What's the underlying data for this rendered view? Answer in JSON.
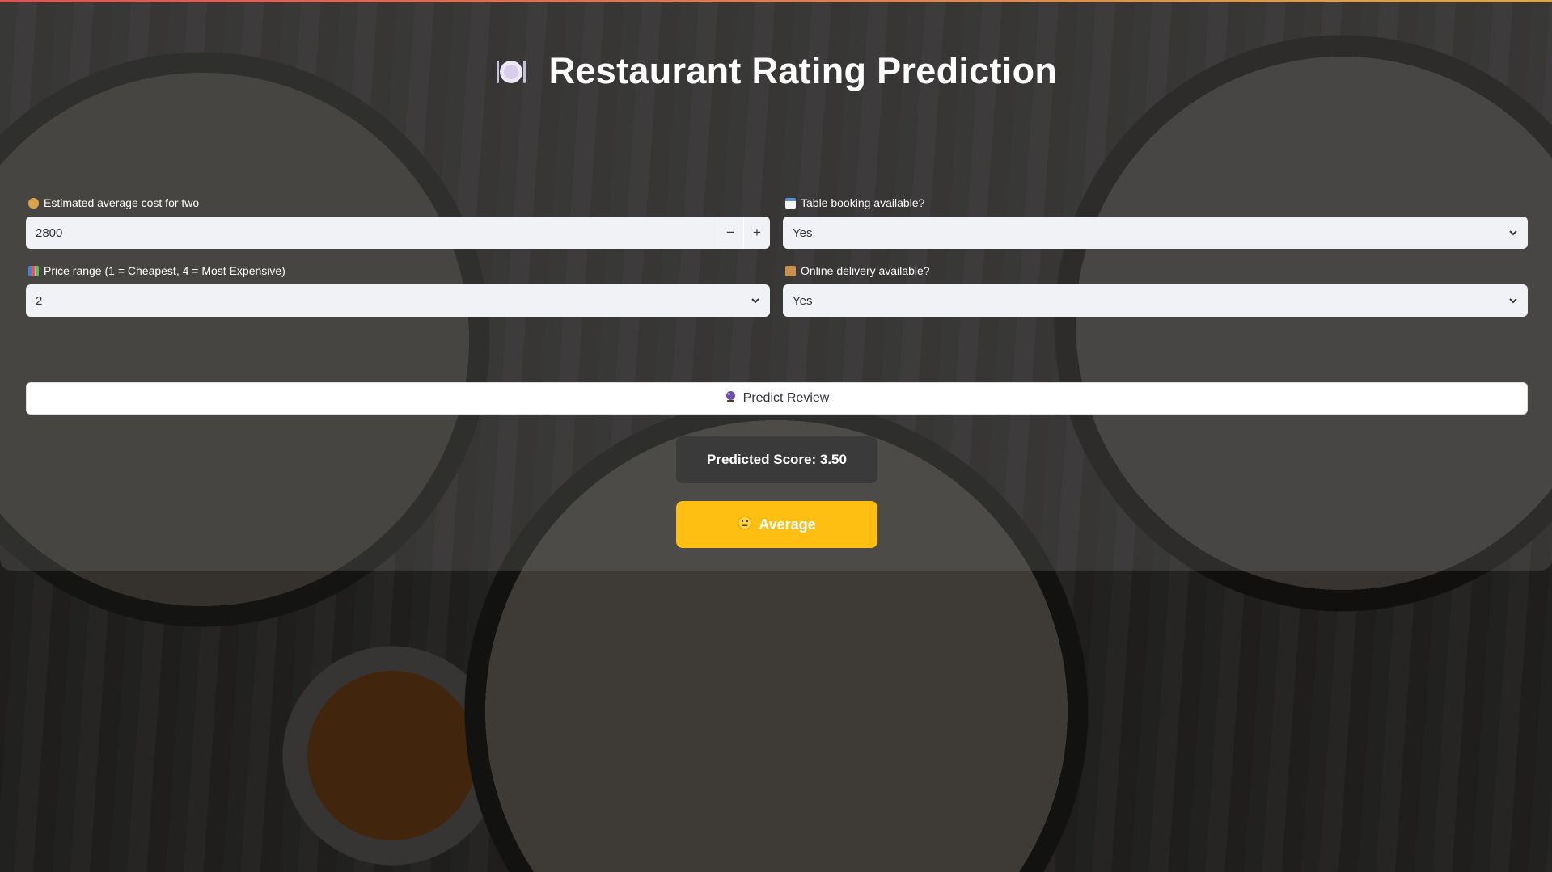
{
  "app": {
    "title": "Restaurant Rating Prediction",
    "title_icon": "plate-cutlery-icon",
    "accent_gradient": [
      "#ff4b4b",
      "#ffbd45"
    ]
  },
  "form": {
    "cost": {
      "label": "Estimated average cost for two",
      "icon": "money-bag-icon",
      "value": "2800",
      "decrement": "−",
      "increment": "+"
    },
    "table_booking": {
      "label": "Table booking available?",
      "icon": "calendar-icon",
      "value": "Yes"
    },
    "price_range": {
      "label": "Price range (1 = Cheapest, 4 = Most Expensive)",
      "icon": "bar-chart-icon",
      "value": "2"
    },
    "online_delivery": {
      "label": "Online delivery available?",
      "icon": "package-icon",
      "value": "Yes"
    }
  },
  "predict_button": {
    "label": "Predict Review",
    "icon": "crystal-ball-icon"
  },
  "result": {
    "score_text": "Predicted Score: 3.50",
    "verdict": "Average",
    "verdict_icon": "neutral-face-icon",
    "verdict_color": "#ffbf12"
  }
}
